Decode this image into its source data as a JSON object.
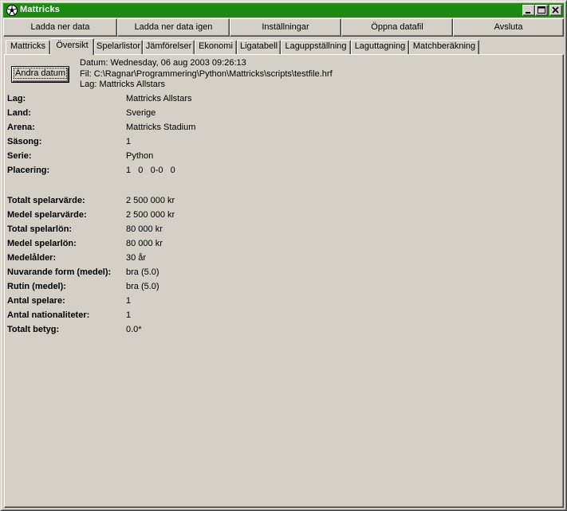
{
  "window": {
    "title": "Mattricks"
  },
  "toolbar": {
    "buttons": [
      "Ladda ner data",
      "Ladda ner data igen",
      "Inställningar",
      "Öppna datafil",
      "Avsluta"
    ]
  },
  "tabs": {
    "items": [
      "Mattricks",
      "Översikt",
      "Spelarlistor",
      "Jämförelser",
      "Ekonomi",
      "Ligatabell",
      "Laguppställning",
      "Laguttagning",
      "Matchberäkning"
    ],
    "active": "Översikt"
  },
  "overview": {
    "change_date_label": "Ändra datum",
    "date_line": "Datum: Wednesday, 06 aug 2003 09:26:13",
    "file_line": "Fil: C:\\Ragnar\\Programmering\\Python\\Mattricks\\scripts\\testfile.hrf",
    "team_line": "Lag: Mattricks Allstars",
    "rows": [
      {
        "label": "Lag:",
        "value": "Mattricks Allstars"
      },
      {
        "label": "Land:",
        "value": "Sverige"
      },
      {
        "label": "Arena:",
        "value": "Mattricks Stadium"
      },
      {
        "label": "Säsong:",
        "value": "1"
      },
      {
        "label": "Serie:",
        "value": "Python"
      },
      {
        "label": "Placering:",
        "value": "1   0   0-0   0"
      }
    ],
    "stats": [
      {
        "label": "Totalt spelarvärde:",
        "value": "2 500 000 kr"
      },
      {
        "label": "Medel spelarvärde:",
        "value": "2 500 000 kr"
      },
      {
        "label": "Total spelarlön:",
        "value": "80 000 kr"
      },
      {
        "label": "Medel spelarlön:",
        "value": "80 000 kr"
      },
      {
        "label": "Medelålder:",
        "value": "30 år"
      },
      {
        "label": "Nuvarande form (medel):",
        "value": "bra (5.0)"
      },
      {
        "label": "Rutin (medel):",
        "value": "bra (5.0)"
      },
      {
        "label": "Antal spelare:",
        "value": "1"
      },
      {
        "label": "Antal nationaliteter:",
        "value": "1"
      },
      {
        "label": "Totalt betyg:",
        "value": "0.0*"
      }
    ]
  },
  "colors": {
    "titlebar": "#1e8a14",
    "face": "#d4d0c8"
  }
}
